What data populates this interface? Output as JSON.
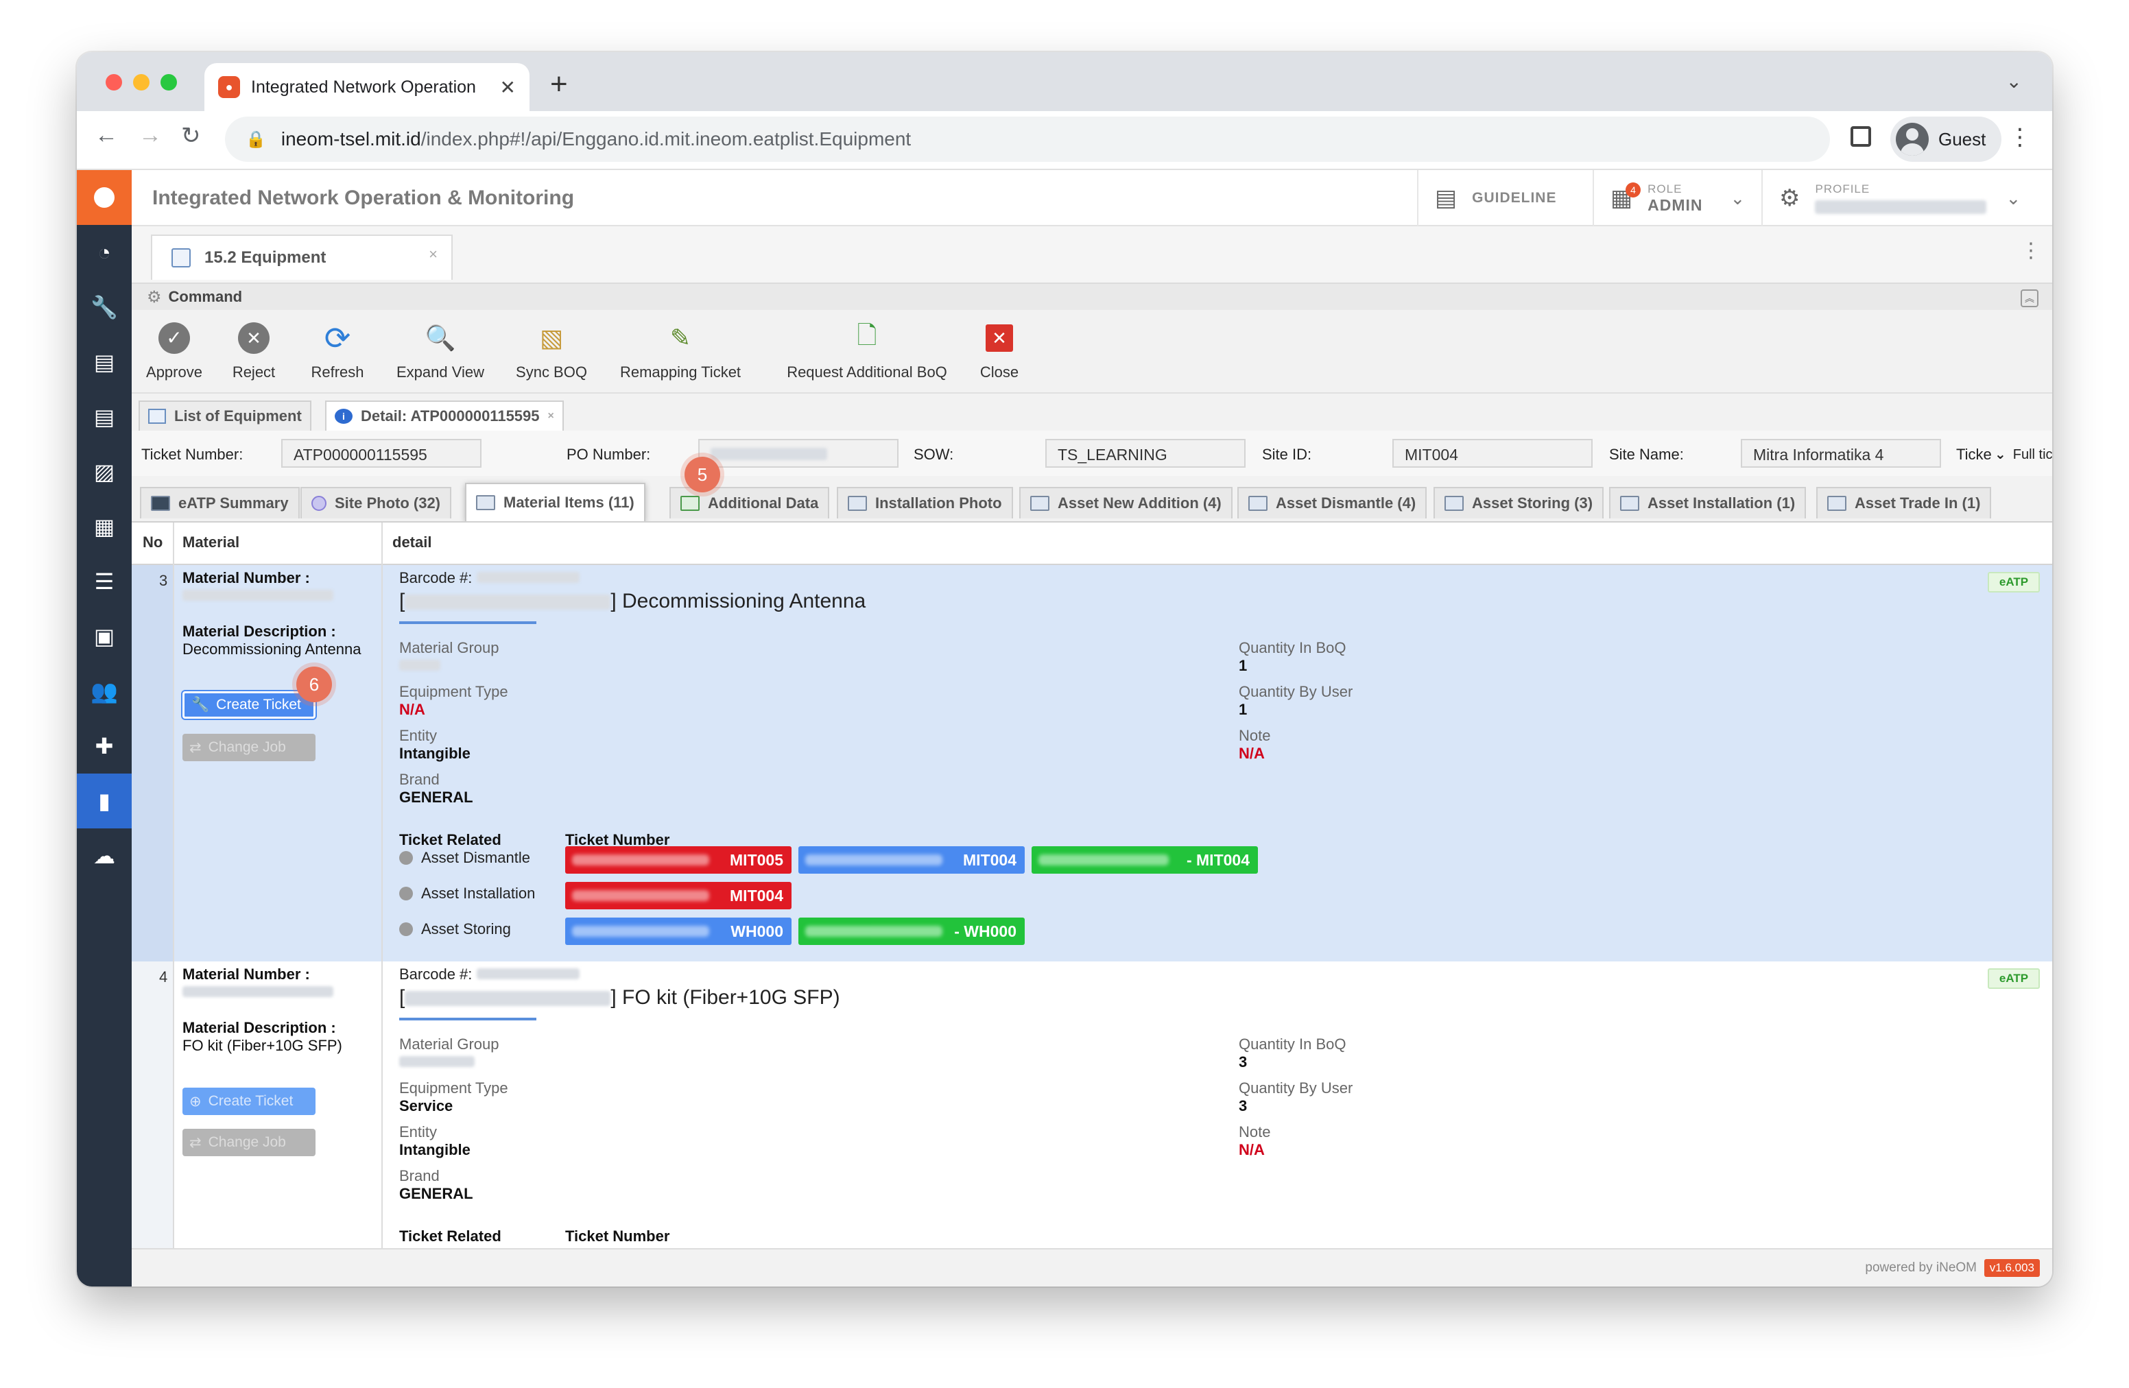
{
  "browser": {
    "tab_title": "Integrated Network Operation",
    "url_host": "ineom-tsel.mit.id",
    "url_path": "/index.php#!/api/Enggano.id.mit.ineom.eatplist.Equipment",
    "profile_label": "Guest"
  },
  "app": {
    "title": "Integrated Network Operation & Monitoring",
    "guideline_label": "GUIDELINE",
    "role_caption": "ROLE",
    "role_value": "ADMIN",
    "role_badge": "4",
    "profile_caption": "PROFILE"
  },
  "doc_tab": {
    "label": "15.2 Equipment",
    "close": "×"
  },
  "command": {
    "header": "Command",
    "buttons": [
      {
        "label": "Approve",
        "icon": "check-circle-icon"
      },
      {
        "label": "Reject",
        "icon": "x-circle-icon"
      },
      {
        "label": "Refresh",
        "icon": "refresh-icon"
      },
      {
        "label": "Expand View",
        "icon": "magnifier-page-icon"
      },
      {
        "label": "Sync BOQ",
        "icon": "sync-document-icon"
      },
      {
        "label": "Remapping Ticket",
        "icon": "pencil-icon"
      },
      {
        "label": "Request Additional BoQ",
        "icon": "document-add-icon"
      },
      {
        "label": "Close",
        "icon": "close-red-icon"
      }
    ]
  },
  "sub_tabs": {
    "list": "List of Equipment",
    "detail": "Detail: ATP000000115595",
    "close": "×"
  },
  "ticket_info": {
    "ticket_number_label": "Ticket Number:",
    "ticket_number": "ATP000000115595",
    "po_number_label": "PO Number:",
    "sow_label": "SOW:",
    "sow": "TS_LEARNING",
    "site_id_label": "Site ID:",
    "site_id": "MIT004",
    "site_name_label": "Site Name:",
    "site_name": "Mitra Informatika 4",
    "ticket_trunc": "Ticke",
    "full_ticket_info": "Full ticket info"
  },
  "material_tabs": [
    "eATP Summary",
    "Site Photo (32)",
    "Material Items (11)",
    "Additional Data",
    "Installation Photo",
    "Asset New Addition (4)",
    "Asset Dismantle (4)",
    "Asset Storing (3)",
    "Asset Installation (1)",
    "Asset Trade In (1)"
  ],
  "markers": {
    "m5": "5",
    "m6": "6"
  },
  "grid": {
    "col_no": "No",
    "col_material": "Material",
    "col_detail": "detail",
    "rows": [
      {
        "no": "3",
        "material_number_label": "Material Number :",
        "material_description_label": "Material Description :",
        "material_description": "Decommissioning Antenna",
        "create_ticket": "Create Ticket",
        "change_job": "Change Job",
        "barcode_label": "Barcode #:",
        "title_open": "[",
        "title_close": "] Decommissioning Antenna",
        "eatp": "eATP",
        "material_group_label": "Material Group",
        "equipment_type_label": "Equipment Type",
        "equipment_type": "N/A",
        "entity_label": "Entity",
        "entity": "Intangible",
        "brand_label": "Brand",
        "brand": "GENERAL",
        "qty_boq_label": "Quantity In BoQ",
        "qty_boq": "1",
        "qty_user_label": "Quantity By User",
        "qty_user": "1",
        "note_label": "Note",
        "note": "N/A",
        "ticket_related_label": "Ticket Related",
        "ticket_number_label": "Ticket Number",
        "related": [
          "Asset Dismantle",
          "Asset Installation",
          "Asset Storing"
        ],
        "tickets": [
          [
            "MIT005",
            "MIT004",
            "- MIT004"
          ],
          [
            "MIT004"
          ],
          [
            "WH000",
            "- WH000"
          ]
        ]
      },
      {
        "no": "4",
        "material_number_label": "Material Number :",
        "material_description_label": "Material Description :",
        "material_description": "FO kit (Fiber+10G SFP)",
        "create_ticket": "Create Ticket",
        "change_job": "Change Job",
        "barcode_label": "Barcode #:",
        "title_open": "[",
        "title_close": "] FO kit (Fiber+10G SFP)",
        "eatp": "eATP",
        "material_group_label": "Material Group",
        "equipment_type_label": "Equipment Type",
        "equipment_type": "Service",
        "entity_label": "Entity",
        "entity": "Intangible",
        "brand_label": "Brand",
        "brand": "GENERAL",
        "qty_boq_label": "Quantity In BoQ",
        "qty_boq": "3",
        "qty_user_label": "Quantity By User",
        "qty_user": "3",
        "note_label": "Note",
        "note": "N/A",
        "ticket_related_label": "Ticket Related",
        "ticket_number_label": "Ticket Number"
      }
    ]
  },
  "footer": {
    "powered": "powered by iNeOM",
    "version": "v1.6.003"
  },
  "colors": {
    "accent": "#2e6bd0",
    "brand": "#f26a2b",
    "ticket_red": "#e01a24",
    "ticket_blue": "#4a8af0",
    "ticket_green": "#22c33b"
  }
}
